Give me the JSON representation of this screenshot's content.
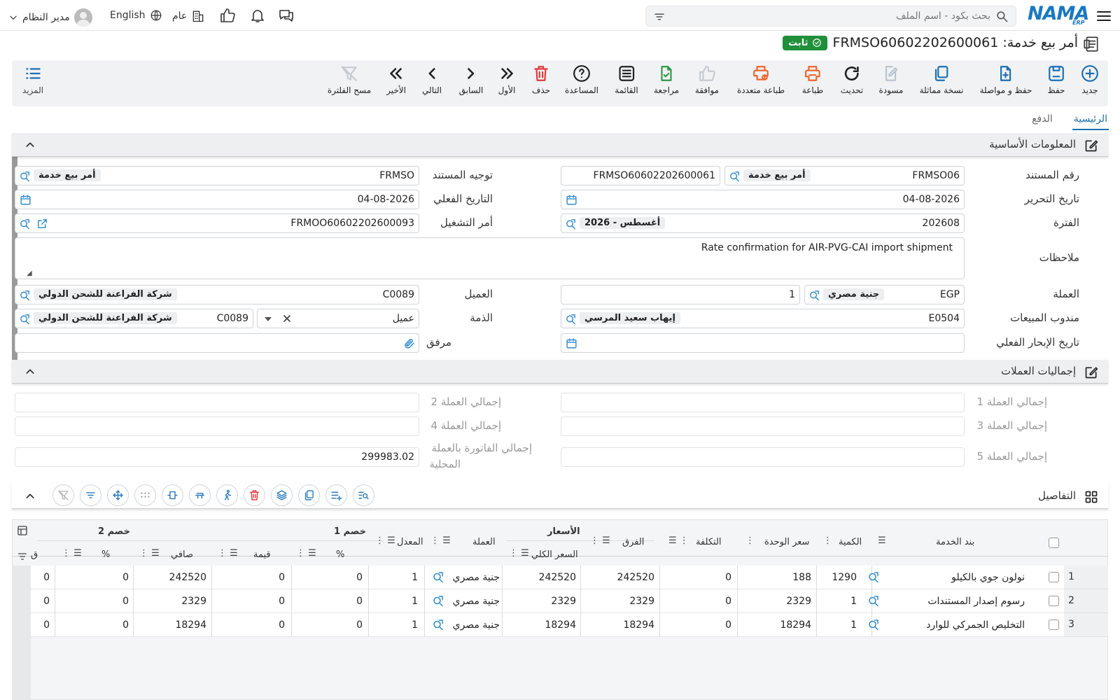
{
  "topbar": {
    "user": "مدير النظام",
    "language": "English",
    "scope": "عام",
    "search_placeholder": "بحث بكود - اسم الملف",
    "logo_text": "NAMA",
    "logo_sub": "ERP"
  },
  "document": {
    "title": "أمر بيع خدمة: FRMSO60602202600061",
    "status": "ثابت"
  },
  "toolbar": {
    "new": "جديد",
    "save": "حفظ",
    "save_continue": "حفظ و مواصلة",
    "duplicate": "نسخة مماثلة",
    "draft": "مسودة",
    "refresh": "تحديث",
    "print": "طباعة",
    "multi_print": "طباعة متعددة",
    "approve": "موافقة",
    "review": "مراجعة",
    "list": "القائمة",
    "help": "المساعدة",
    "delete": "حذف",
    "first": "الأول",
    "previous": "السابق",
    "next": "التالي",
    "last": "الأخير",
    "clear_filter": "مسح الفلترة",
    "more": "المزيد"
  },
  "tabs": {
    "main": "الرئيسية",
    "payment": "الدفع"
  },
  "basic": {
    "section_title": "المعلومات الأساسية",
    "doc_number_label": "رقم المستند",
    "doc_number_code": "FRMSO06",
    "doc_number_type": "أمر بيع خدمة",
    "doc_number_value": "FRMSO60602202600061",
    "direction_label": "توجيه المستند",
    "direction_code": "FRMSO",
    "direction_type": "أمر بيع خدمة",
    "issue_date_label": "تاريخ التحرير",
    "issue_date": "04-08-2026",
    "actual_date_label": "التاريخ الفعلي",
    "actual_date": "04-08-2026",
    "period_label": "الفترة",
    "period_code": "202608",
    "period_name": "2026 - أغسطس",
    "operation_label": "أمر التشغيل",
    "operation_value": "FRMOO60602202600093",
    "notes_label": "ملاحظات",
    "notes_value": "Rate confirmation for AIR-PVG-CAI import shipment",
    "currency_label": "العملة",
    "currency_code": "EGP",
    "currency_name": "جنية مصري",
    "currency_rate": "1",
    "customer_label": "العميل",
    "customer_code": "C0089",
    "customer_name": "شركة الفراعنة للشحن الدولي",
    "salesman_label": "مندوب المبيعات",
    "salesman_code": "E0504",
    "salesman_name": "إيهاب سعيد المرسي",
    "account_label": "الذمة",
    "account_type": "عميل",
    "account_code": "C0089",
    "account_name": "شركة الفراعنة للشحن الدولي",
    "sailing_date_label": "تاريخ الإبحار الفعلي",
    "attachment_label": "مرفق"
  },
  "totals": {
    "section_title": "إجماليات العملات",
    "c1": "إجمالي العملة 1",
    "c2": "إجمالي العملة 2",
    "c3": "إجمالي العملة 3",
    "c4": "إجمالي العملة 4",
    "c5": "إجمالي العملة 5",
    "local_label_1": "إجمالي الفاتورة بالعملة",
    "local_label_2": "المحلية",
    "local_value": "299983.02"
  },
  "details": {
    "section_title": "التفاصيل",
    "headers": {
      "service_item": "بند الخدمة",
      "qty": "الكمية",
      "unit_price": "سعر الوحدة",
      "cost": "التكلفة",
      "diff": "الفرق",
      "prices_group": "الأسعار",
      "total_price": "السعر الكلي",
      "currency": "العملة",
      "rate": "المعدل",
      "discount1": "خصم 1",
      "discount2": "خصم 2",
      "pct": "%",
      "value": "قيمة",
      "net": "صافي",
      "extra": "ق"
    },
    "rows": [
      {
        "n": "1",
        "item": "نولون جوي بالكيلو",
        "qty": "1290",
        "unit": "188",
        "cost": "0",
        "diff": "242520",
        "total": "242520",
        "currency": "جنية مصري",
        "rate": "1",
        "d1pct": "0",
        "d1val": "0",
        "net": "242520",
        "d2pct": "0",
        "extra": "0"
      },
      {
        "n": "2",
        "item": "رسوم إصدار المستندات",
        "qty": "1",
        "unit": "2329",
        "cost": "0",
        "diff": "2329",
        "total": "2329",
        "currency": "جنية مصري",
        "rate": "1",
        "d1pct": "0",
        "d1val": "0",
        "net": "2329",
        "d2pct": "0",
        "extra": "0"
      },
      {
        "n": "3",
        "item": "التخليص الجمركي للوارد",
        "qty": "1",
        "unit": "18294",
        "cost": "0",
        "diff": "18294",
        "total": "18294",
        "currency": "جنية مصري",
        "rate": "1",
        "d1pct": "0",
        "d1val": "0",
        "net": "18294",
        "d2pct": "0",
        "extra": "0"
      }
    ]
  }
}
